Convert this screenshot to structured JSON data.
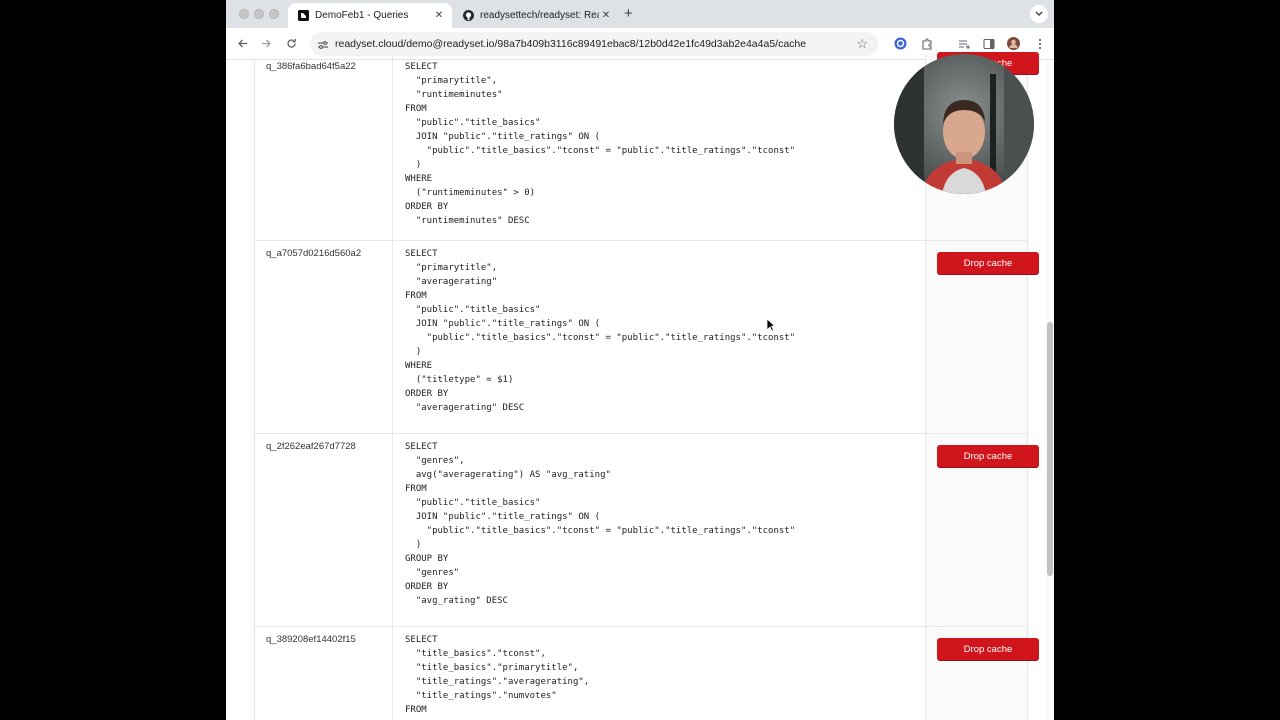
{
  "browser": {
    "tabs": [
      {
        "title": "DemoFeb1 - Queries",
        "active": true,
        "favicon": "readyset-logo-icon"
      },
      {
        "title": "readysettech/readyset: Ready",
        "active": false,
        "favicon": "github-icon"
      }
    ],
    "new_tab": "+",
    "url": "readyset.cloud/demo@readyset.io/98a7b409b3116c89491ebac8/12b0d42e1fc49d3ab2e4a4a5/cache"
  },
  "queries": [
    {
      "id": "q_386fa6bad64f5a22",
      "sql": "SELECT\n  \"primarytitle\",\n  \"runtimeminutes\"\nFROM\n  \"public\".\"title_basics\"\n  JOIN \"public\".\"title_ratings\" ON (\n    \"public\".\"title_basics\".\"tconst\" = \"public\".\"title_ratings\".\"tconst\"\n  )\nWHERE\n  (\"runtimeminutes\" > 0)\nORDER BY\n  \"runtimeminutes\" DESC",
      "action": "Drop cache"
    },
    {
      "id": "q_a7057d0216d560a2",
      "sql": "SELECT\n  \"primarytitle\",\n  \"averagerating\"\nFROM\n  \"public\".\"title_basics\"\n  JOIN \"public\".\"title_ratings\" ON (\n    \"public\".\"title_basics\".\"tconst\" = \"public\".\"title_ratings\".\"tconst\"\n  )\nWHERE\n  (\"titletype\" = $1)\nORDER BY\n  \"averagerating\" DESC",
      "action": "Drop cache"
    },
    {
      "id": "q_2f262eaf267d7728",
      "sql": "SELECT\n  \"genres\",\n  avg(\"averagerating\") AS \"avg_rating\"\nFROM\n  \"public\".\"title_basics\"\n  JOIN \"public\".\"title_ratings\" ON (\n    \"public\".\"title_basics\".\"tconst\" = \"public\".\"title_ratings\".\"tconst\"\n  )\nGROUP BY\n  \"genres\"\nORDER BY\n  \"avg_rating\" DESC",
      "action": "Drop cache"
    },
    {
      "id": "q_389208ef14402f15",
      "sql": "SELECT\n  \"title_basics\".\"tconst\",\n  \"title_basics\".\"primarytitle\",\n  \"title_ratings\".\"averagerating\",\n  \"title_ratings\".\"numvotes\"\nFROM",
      "action": "Drop cache"
    }
  ],
  "colors": {
    "drop_button": "#d0161c",
    "brand": "#d0161c"
  }
}
